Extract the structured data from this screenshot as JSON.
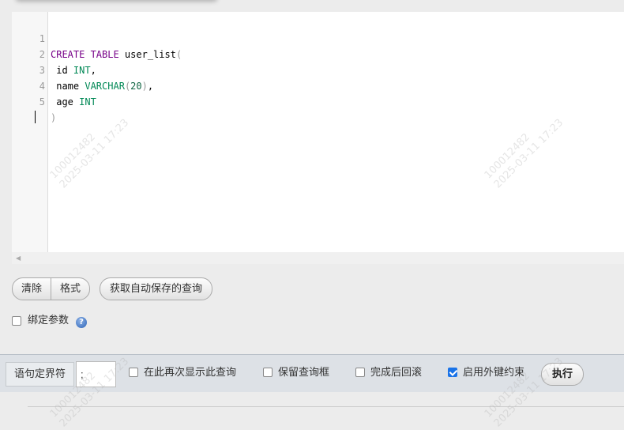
{
  "editor": {
    "line_numbers": [
      "1",
      "2",
      "3",
      "4",
      "5"
    ],
    "lines": [
      [
        {
          "t": "CREATE TABLE",
          "c": "kw"
        },
        {
          "t": " user_list",
          "c": ""
        },
        {
          "t": "(",
          "c": "paren"
        }
      ],
      [
        {
          "t": " id ",
          "c": ""
        },
        {
          "t": "INT",
          "c": "ty"
        },
        {
          "t": ",",
          "c": ""
        }
      ],
      [
        {
          "t": " name ",
          "c": ""
        },
        {
          "t": "VARCHAR",
          "c": "ty"
        },
        {
          "t": "(",
          "c": "paren"
        },
        {
          "t": "20",
          "c": "num"
        },
        {
          "t": ")",
          "c": "paren"
        },
        {
          "t": ",",
          "c": ""
        }
      ],
      [
        {
          "t": " age ",
          "c": ""
        },
        {
          "t": "INT",
          "c": "ty"
        }
      ],
      [
        {
          "t": ")",
          "c": "paren"
        }
      ]
    ]
  },
  "buttons": {
    "clear": "清除",
    "format": "格式",
    "get_autosaved": "获取自动保存的查询"
  },
  "bind_params": {
    "label": "绑定参数",
    "checked": false,
    "help_icon": "help-icon"
  },
  "bottom_bar": {
    "delimiter_label": "语句定界符",
    "delimiter_value": ";",
    "show_query_again": {
      "label": "在此再次显示此查询",
      "checked": false
    },
    "retain_query_box": {
      "label": "保留查询框",
      "checked": false
    },
    "rollback_after": {
      "label": "完成后回滚",
      "checked": false
    },
    "enable_fk": {
      "label": "启用外键约束",
      "checked": true
    },
    "execute": "执行"
  },
  "watermark": {
    "line1": "100012482",
    "line2": "2025-03-11 17:23"
  },
  "colors": {
    "keyword": "#770088",
    "type": "#008855",
    "number": "#116644",
    "checkbox_checked": "#1a73e8"
  }
}
